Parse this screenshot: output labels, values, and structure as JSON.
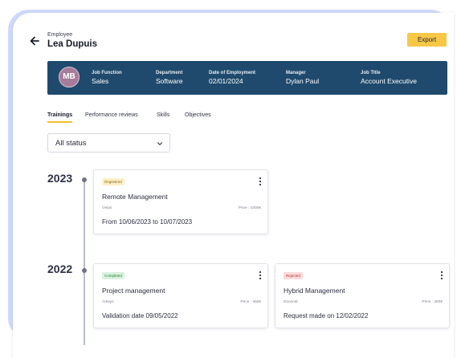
{
  "header": {
    "eyebrow": "Employee",
    "name": "Lea Dupuis",
    "export_label": "Export"
  },
  "banner": {
    "avatar_initials": "MB",
    "fields": [
      {
        "label": "Job Function",
        "value": "Sales"
      },
      {
        "label": "Department",
        "value": "Software"
      },
      {
        "label": "Date of Employment",
        "value": "02/01/2024"
      },
      {
        "label": "Manager",
        "value": "Dylan Paul"
      },
      {
        "label": "Job Title",
        "value": "Account Executive"
      }
    ]
  },
  "tabs": [
    "Trainings",
    "Performance reviews",
    "Skills",
    "Objectives"
  ],
  "active_tab": "Trainings",
  "filter": {
    "selected": "All status"
  },
  "timeline": [
    {
      "year": "2023",
      "cards": [
        {
          "status": "Registered",
          "title": "Remote Management",
          "provider": "Onlys",
          "price": "Price : 1000€",
          "detail": "From 10/06/2023 to 10/07/2023"
        }
      ]
    },
    {
      "year": "2022",
      "cards": [
        {
          "status": "Completed",
          "title": "Project management",
          "provider": "Arkeys",
          "price": "Price : 450€",
          "detail": "Validation date 09/05/2022"
        },
        {
          "status": "Rejected",
          "title": "Hybrid Management",
          "provider": "Docendi",
          "price": "Price : 250€",
          "detail": "Request made on 12/02/2022"
        }
      ]
    }
  ],
  "colors": {
    "banner": "#1f4a6d",
    "export": "#f7c745",
    "frame": "#cfd9fb",
    "avatar": "#a77c9a",
    "tab_underline": "#f2bd33"
  }
}
